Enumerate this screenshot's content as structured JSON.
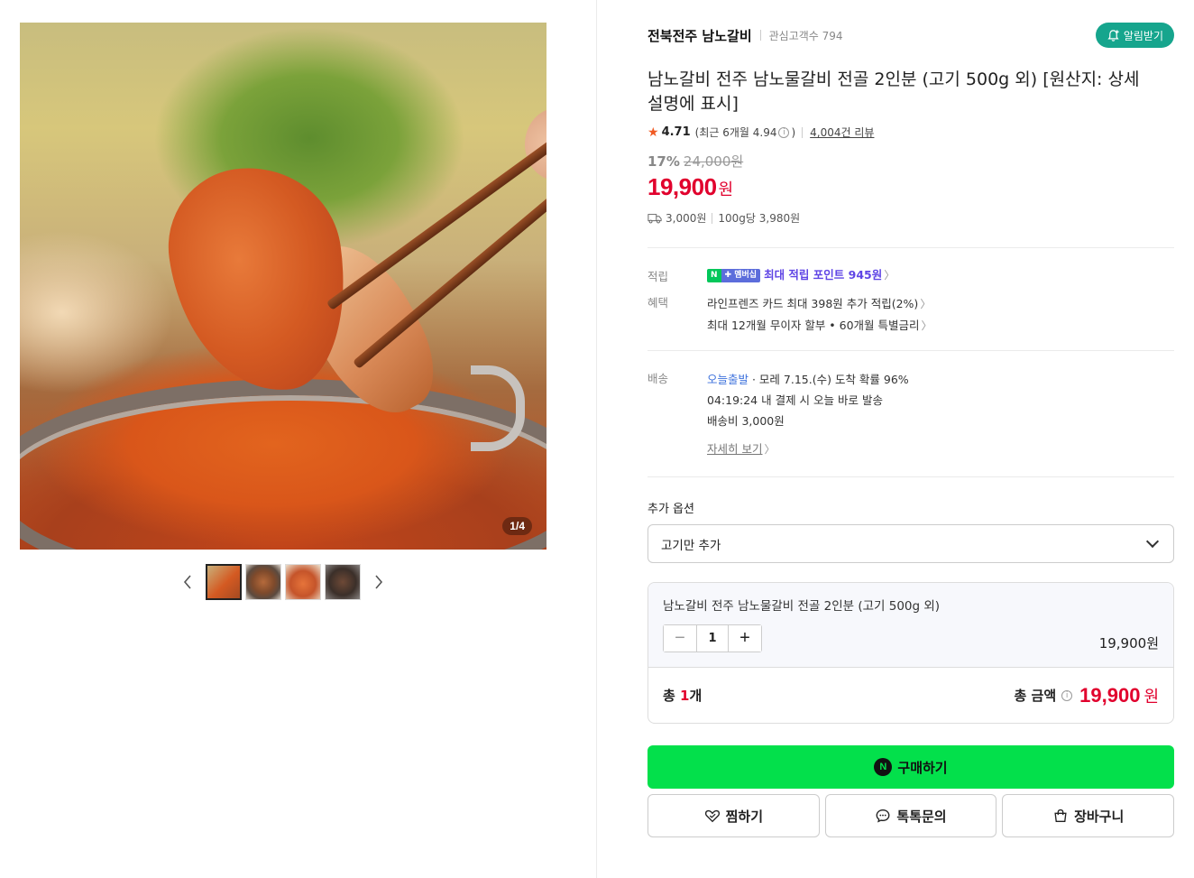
{
  "gallery": {
    "counter_current": "1",
    "counter_total": "4",
    "prev_icon": "chevron-left-icon",
    "next_icon": "chevron-right-icon"
  },
  "store": {
    "name": "전북전주 남노갈비",
    "fans_label": "관심고객수 794",
    "alarm_label": "알림받기"
  },
  "product": {
    "title": "남노갈비 전주 남노물갈비 전골 2인분 (고기 500g 외) [원산지: 상세설명에 표시]",
    "rating": "4.71",
    "rating_recent": "(최근 6개월 4.94",
    "rating_recent_close": ")",
    "review_count": "4,004건 리뷰",
    "discount": "17%",
    "original_price": "24,000원",
    "price": "19,900",
    "price_unit": "원",
    "shipping_fee": "3,000원",
    "unit_price": "100g당 3,980원"
  },
  "benefits": {
    "points_label": "적립",
    "badge_n": "N",
    "badge_member": "✚ 멤버십",
    "points_text": "최대 적립 포인트 945원",
    "benefit_label": "혜택",
    "card_benefit": "라인프렌즈 카드 최대 398원 추가 적립(2%)",
    "installment": "최대 12개월 무이자 할부 • 60개월 특별금리"
  },
  "delivery": {
    "label": "배송",
    "today_ship": "오늘출발",
    "arrival": " · 모레 7.15.(수) 도착 확률 96%",
    "deadline": "04:19:24  내 결제 시 오늘 바로 발송",
    "fee": "배송비 3,000원",
    "detail_link": "자세히 보기"
  },
  "options": {
    "label": "추가 옵션",
    "selected": "고기만 추가"
  },
  "cart": {
    "item_name": "남노갈비 전주 남노물갈비 전골 2인분 (고기 500g 외)",
    "minus": "−",
    "quantity": "1",
    "plus": "+",
    "item_price": "19,900원",
    "total_prefix": "총 ",
    "total_count_num": "1",
    "total_count_suffix": "개",
    "total_label": "총 금액",
    "total_price": "19,900",
    "total_unit": "원"
  },
  "actions": {
    "buy_badge": "N",
    "buy": "구매하기",
    "wish": "찜하기",
    "talk": "톡톡문의",
    "cart": "장바구니"
  },
  "colors": {
    "accent_red": "#e1002d",
    "buy_green": "#03e04b",
    "alarm_teal": "#16a58d",
    "point_purple": "#5f45e5"
  }
}
